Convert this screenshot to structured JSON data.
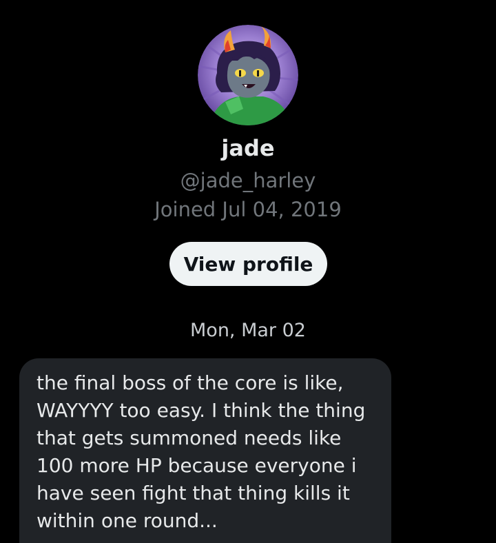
{
  "profile": {
    "display_name": "jade",
    "handle": "@jade_harley",
    "joined": "Joined Jul 04, 2019",
    "avatar_icon": "avatar-icon",
    "view_profile_label": "View profile"
  },
  "conversation": {
    "date_separator": "Mon, Mar 02",
    "messages": [
      {
        "text": "the final boss of the core is like,\nWAYYYY too easy. I think the thing\nthat gets summoned needs like\n100 more HP because everyone i\nhave seen fight that thing kills it\nwithin one round..."
      }
    ]
  },
  "colors": {
    "background": "#000000",
    "bubble": "#202327",
    "primary_text": "#e7e9ea",
    "secondary_text": "#71767b",
    "button_bg": "#eff3f4"
  }
}
